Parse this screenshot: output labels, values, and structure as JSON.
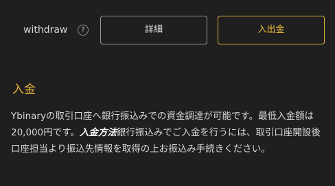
{
  "withdraw": {
    "label": "withdraw",
    "help_glyph": "?",
    "detail_button": "詳細",
    "deposit_button": "入出金"
  },
  "deposit_section": {
    "title": "入金",
    "body_part1": "Ybinaryの取引口座へ銀行振込みでの資金調達が可能です。最低入金額は20,000円です。",
    "emphasis": "入金方法",
    "body_part2": "銀行振込みでご入金を行うには、取引口座開設後口座担当より振込先情報を取得の上お振込み手続きください。"
  },
  "colors": {
    "background": "#1f1f1f",
    "accent": "#e8b43a",
    "button_border": "#9a9a9a"
  }
}
